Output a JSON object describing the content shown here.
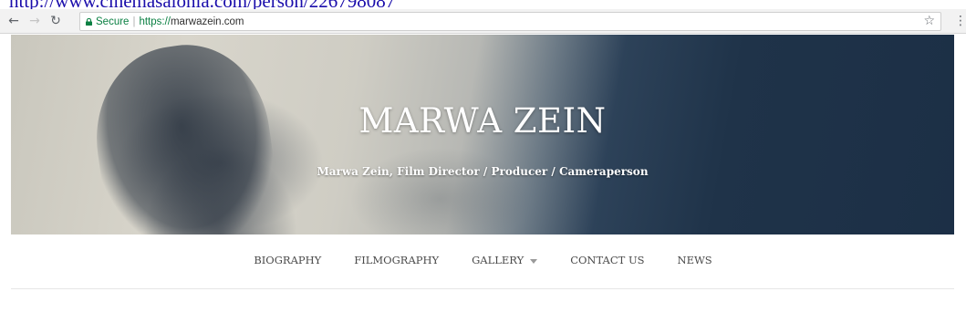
{
  "top_link": {
    "text": "http://www.cinemasalonia.com/person/226798087"
  },
  "browser": {
    "secure_label": "Secure",
    "separator": "|",
    "url_scheme": "https://",
    "url_host": "marwazein.com",
    "icons": {
      "back": "back-arrow-icon",
      "forward": "forward-arrow-icon",
      "reload": "reload-icon",
      "lock": "lock-icon",
      "bookmark": "star-icon",
      "menu": "kebab-menu-icon"
    }
  },
  "hero": {
    "title": "MARWA ZEIN",
    "subtitle": "Marwa Zein, Film Director / Producer / Cameraperson"
  },
  "nav": {
    "items": [
      {
        "label": "BIOGRAPHY"
      },
      {
        "label": "FILMOGRAPHY"
      },
      {
        "label": "GALLERY",
        "has_dropdown": true
      },
      {
        "label": "CONTACT US"
      },
      {
        "label": "NEWS"
      }
    ]
  },
  "colors": {
    "link": "#1a0dab",
    "secure_green": "#0b8043",
    "nav_text": "#4a4a4a",
    "hero_dark": "#1c2f46"
  }
}
